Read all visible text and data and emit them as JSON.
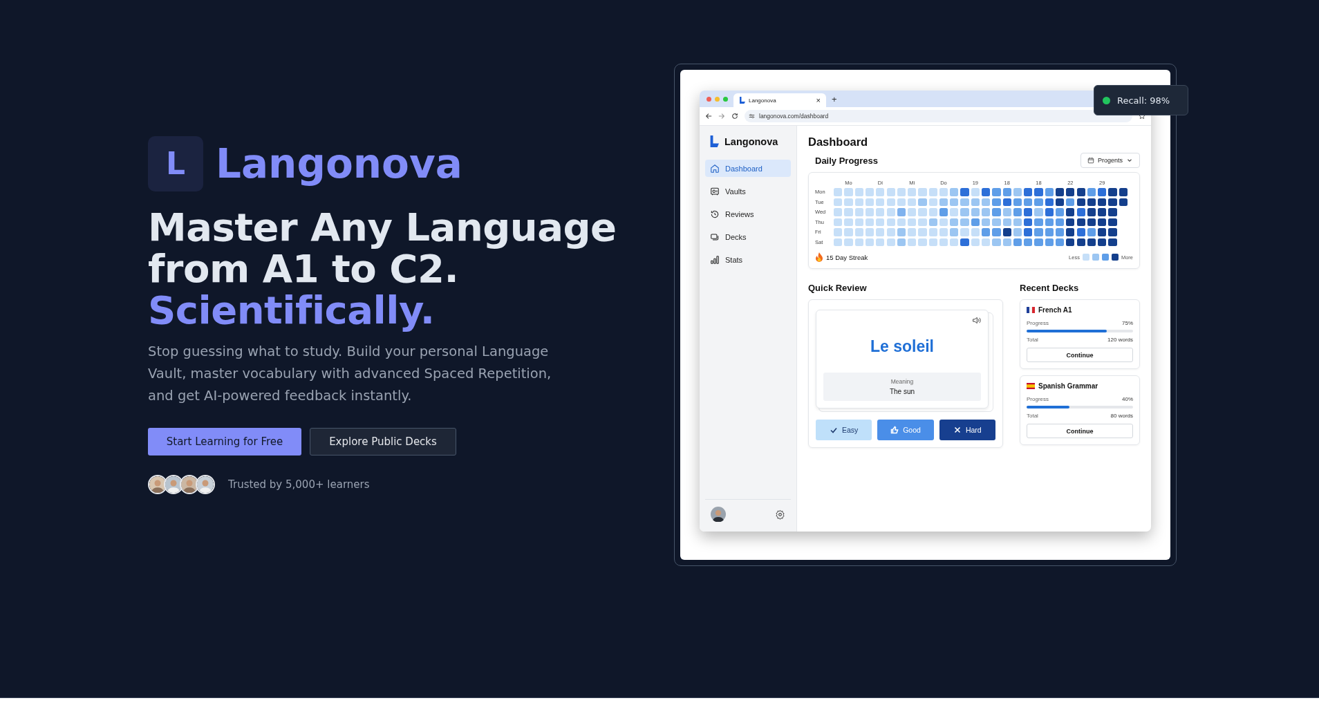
{
  "hero": {
    "logo_letter": "L",
    "brand": "Langonova",
    "headline_lines": [
      "Master Any Language",
      "from A1 to C2."
    ],
    "headline_accent": "Scientifically.",
    "description": "Stop guessing what to study. Build your personal Language Vault, master vocabulary with advanced Spaced Repetition, and get AI-powered feedback instantly.",
    "buttons": [
      {
        "label": "Start Learning for Free",
        "kind": "primary"
      },
      {
        "label": "Explore Public Decks",
        "kind": "secondary"
      }
    ],
    "social_proof": {
      "avatars": [
        {
          "kind": "person"
        },
        {
          "kind": "person"
        },
        {
          "kind": "person"
        },
        {
          "kind": "person"
        }
      ],
      "text": "Trusted by 5,000+ learners"
    }
  },
  "preview": {
    "badge": {
      "text": "Recall: 98%",
      "color": "#22c55e"
    },
    "browser": {
      "tab_title": "Langonova",
      "tab_close": "×",
      "new_tab": "+",
      "url": "langonova.com/dashboard"
    },
    "app": {
      "brand": "Langonova",
      "nav": [
        {
          "label": "Dashboard",
          "selected": true
        },
        {
          "label": "Vaults",
          "selected": false
        },
        {
          "label": "Reviews",
          "selected": false
        },
        {
          "label": "Decks",
          "selected": false
        },
        {
          "label": "Stats",
          "selected": false
        }
      ],
      "page_title": "Dashboard",
      "daily_progress": {
        "title": "Daily Progress",
        "filter": "Progents",
        "column_labels": [
          "Mo",
          "Di",
          "Mi",
          "Do",
          "19",
          "18",
          "18",
          "22",
          "29"
        ],
        "rows": [
          {
            "day": "Mon",
            "cells": [
              {
                "color": "#c6dff8"
              },
              {
                "color": "#c6dff8"
              },
              {
                "color": "#c6dff8"
              },
              {
                "color": "#c6dff8"
              },
              {
                "color": "#c6dff8"
              },
              {
                "color": "#c6dff8"
              },
              {
                "color": "#c6dff8"
              },
              {
                "color": "#c6dff8"
              },
              {
                "color": "#c6dff8"
              },
              {
                "color": "#c6dff8"
              },
              {
                "color": "#c6dff8"
              },
              {
                "color": "#9cc6f2"
              },
              {
                "color": "#2d6fd8"
              },
              {
                "color": "#c6dff8"
              },
              {
                "color": "#2d6fd8"
              },
              {
                "color": "#5f9ee8"
              },
              {
                "color": "#5f9ee8"
              },
              {
                "color": "#9cc6f2"
              },
              {
                "color": "#2d6fd8"
              },
              {
                "color": "#2d6fd8"
              },
              {
                "color": "#5f9ee8"
              },
              {
                "color": "#143f8c"
              },
              {
                "color": "#143f8c"
              },
              {
                "color": "#143f8c"
              },
              {
                "color": "#5f9ee8"
              },
              {
                "color": "#2d6fd8"
              },
              {
                "color": "#143f8c"
              },
              {
                "color": "#143f8c"
              }
            ]
          },
          {
            "day": "Tue",
            "cells": [
              {
                "color": "#c6dff8"
              },
              {
                "color": "#c6dff8"
              },
              {
                "color": "#c6dff8"
              },
              {
                "color": "#c6dff8"
              },
              {
                "color": "#c6dff8"
              },
              {
                "color": "#c6dff8"
              },
              {
                "color": "#c6dff8"
              },
              {
                "color": "#c6dff8"
              },
              {
                "color": "#9cc6f2"
              },
              {
                "color": "#c6dff8"
              },
              {
                "color": "#9cc6f2"
              },
              {
                "color": "#9cc6f2"
              },
              {
                "color": "#9cc6f2"
              },
              {
                "color": "#9cc6f2"
              },
              {
                "color": "#9cc6f2"
              },
              {
                "color": "#5f9ee8"
              },
              {
                "color": "#2d6fd8"
              },
              {
                "color": "#5f9ee8"
              },
              {
                "color": "#5f9ee8"
              },
              {
                "color": "#5f9ee8"
              },
              {
                "color": "#2d6fd8"
              },
              {
                "color": "#143f8c"
              },
              {
                "color": "#5f9ee8"
              },
              {
                "color": "#143f8c"
              },
              {
                "color": "#143f8c"
              },
              {
                "color": "#143f8c"
              },
              {
                "color": "#143f8c"
              },
              {
                "color": "#143f8c"
              }
            ]
          },
          {
            "day": "Wed",
            "cells": [
              {
                "color": "#c6dff8"
              },
              {
                "color": "#c6dff8"
              },
              {
                "color": "#c6dff8"
              },
              {
                "color": "#c6dff8"
              },
              {
                "color": "#c6dff8"
              },
              {
                "color": "#c6dff8"
              },
              {
                "color": "#7fb2ee"
              },
              {
                "color": "#c6dff8"
              },
              {
                "color": "#c6dff8"
              },
              {
                "color": "#c6dff8"
              },
              {
                "color": "#5f9ee8"
              },
              {
                "color": "#c6dff8"
              },
              {
                "color": "#9cc6f2"
              },
              {
                "color": "#9cc6f2"
              },
              {
                "color": "#9cc6f2"
              },
              {
                "color": "#5f9ee8"
              },
              {
                "color": "#9cc6f2"
              },
              {
                "color": "#5f9ee8"
              },
              {
                "color": "#2d6fd8"
              },
              {
                "color": "#9cc6f2"
              },
              {
                "color": "#2d6fd8"
              },
              {
                "color": "#5f9ee8"
              },
              {
                "color": "#143f8c"
              },
              {
                "color": "#2d6fd8"
              },
              {
                "color": "#143f8c"
              },
              {
                "color": "#143f8c"
              },
              {
                "color": "#143f8c"
              }
            ]
          },
          {
            "day": "Thu",
            "cells": [
              {
                "color": "#c6dff8"
              },
              {
                "color": "#c6dff8"
              },
              {
                "color": "#c6dff8"
              },
              {
                "color": "#c6dff8"
              },
              {
                "color": "#c6dff8"
              },
              {
                "color": "#c6dff8"
              },
              {
                "color": "#c6dff8"
              },
              {
                "color": "#c6dff8"
              },
              {
                "color": "#c6dff8"
              },
              {
                "color": "#9cc6f2"
              },
              {
                "color": "#c6dff8"
              },
              {
                "color": "#9cc6f2"
              },
              {
                "color": "#9cc6f2"
              },
              {
                "color": "#5f9ee8"
              },
              {
                "color": "#9cc6f2"
              },
              {
                "color": "#9cc6f2"
              },
              {
                "color": "#9cc6f2"
              },
              {
                "color": "#9cc6f2"
              },
              {
                "color": "#2d6fd8"
              },
              {
                "color": "#5f9ee8"
              },
              {
                "color": "#5f9ee8"
              },
              {
                "color": "#5f9ee8"
              },
              {
                "color": "#143f8c"
              },
              {
                "color": "#143f8c"
              },
              {
                "color": "#143f8c"
              },
              {
                "color": "#143f8c"
              },
              {
                "color": "#143f8c"
              }
            ]
          },
          {
            "day": "Fri",
            "cells": [
              {
                "color": "#c6dff8"
              },
              {
                "color": "#c6dff8"
              },
              {
                "color": "#c6dff8"
              },
              {
                "color": "#c6dff8"
              },
              {
                "color": "#c6dff8"
              },
              {
                "color": "#c6dff8"
              },
              {
                "color": "#9cc6f2"
              },
              {
                "color": "#c6dff8"
              },
              {
                "color": "#c6dff8"
              },
              {
                "color": "#c6dff8"
              },
              {
                "color": "#c6dff8"
              },
              {
                "color": "#9cc6f2"
              },
              {
                "color": "#c6dff8"
              },
              {
                "color": "#c6dff8"
              },
              {
                "color": "#5f9ee8"
              },
              {
                "color": "#5f9ee8"
              },
              {
                "color": "#143f8c"
              },
              {
                "color": "#9cc6f2"
              },
              {
                "color": "#2d6fd8"
              },
              {
                "color": "#5f9ee8"
              },
              {
                "color": "#5f9ee8"
              },
              {
                "color": "#5f9ee8"
              },
              {
                "color": "#143f8c"
              },
              {
                "color": "#2d6fd8"
              },
              {
                "color": "#5f9ee8"
              },
              {
                "color": "#143f8c"
              },
              {
                "color": "#143f8c"
              }
            ]
          },
          {
            "day": "Sat",
            "cells": [
              {
                "color": "#c6dff8"
              },
              {
                "color": "#c6dff8"
              },
              {
                "color": "#c6dff8"
              },
              {
                "color": "#c6dff8"
              },
              {
                "color": "#c6dff8"
              },
              {
                "color": "#c6dff8"
              },
              {
                "color": "#9cc6f2"
              },
              {
                "color": "#c6dff8"
              },
              {
                "color": "#c6dff8"
              },
              {
                "color": "#c6dff8"
              },
              {
                "color": "#c6dff8"
              },
              {
                "color": "#c6dff8"
              },
              {
                "color": "#2d6fd8"
              },
              {
                "color": "#c6dff8"
              },
              {
                "color": "#c6dff8"
              },
              {
                "color": "#9cc6f2"
              },
              {
                "color": "#9cc6f2"
              },
              {
                "color": "#5f9ee8"
              },
              {
                "color": "#5f9ee8"
              },
              {
                "color": "#5f9ee8"
              },
              {
                "color": "#5f9ee8"
              },
              {
                "color": "#5f9ee8"
              },
              {
                "color": "#143f8c"
              },
              {
                "color": "#143f8c"
              },
              {
                "color": "#143f8c"
              },
              {
                "color": "#143f8c"
              },
              {
                "color": "#143f8c"
              }
            ]
          }
        ],
        "streak": "15 Day Streak",
        "legend": {
          "less": "Less",
          "more": "More",
          "swatches": [
            {
              "color": "#c6dff8"
            },
            {
              "color": "#9cc6f2"
            },
            {
              "color": "#5f9ee8"
            },
            {
              "color": "#143f8c"
            }
          ]
        }
      },
      "quick_review": {
        "title": "Quick Review",
        "word": "Le soleil",
        "meaning_label": "Meaning",
        "meaning": "The sun",
        "buttons": [
          {
            "label": "Easy",
            "kind": "easy"
          },
          {
            "label": "Good",
            "kind": "good"
          },
          {
            "label": "Hard",
            "kind": "hard"
          }
        ]
      },
      "recent_decks": {
        "title": "Recent Decks",
        "decks": [
          {
            "name": "French A1",
            "progress_label": "Progress",
            "progress": "75%",
            "level": 0.75,
            "total_label": "Total",
            "total": "120 words",
            "action": "Continue"
          },
          {
            "name": "Spanish Grammar",
            "progress_label": "Progress",
            "progress": "40%",
            "level": 0.4,
            "total_label": "Total",
            "total": "80 words",
            "action": "Continue"
          }
        ]
      }
    }
  }
}
